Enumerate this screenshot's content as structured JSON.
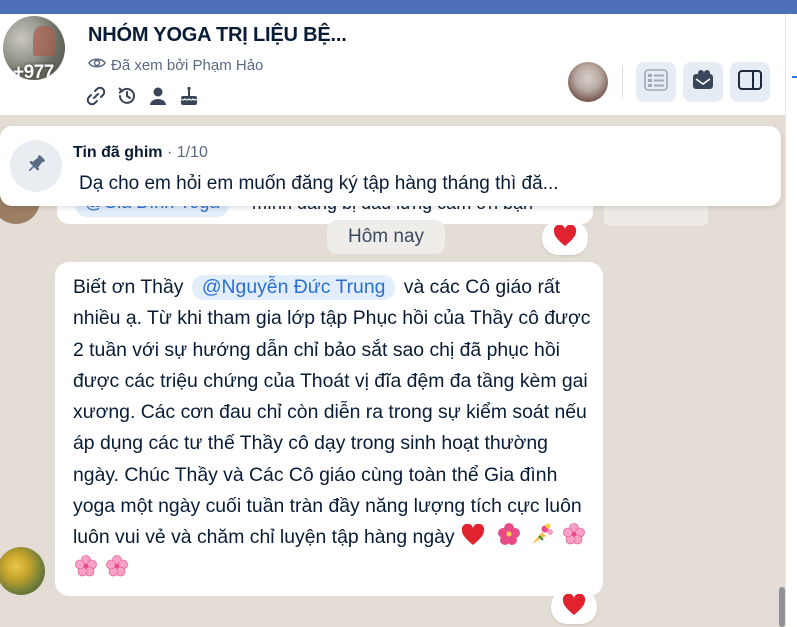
{
  "header": {
    "title": "NHÓM YOGA TRỊ LIỆU BỆ...",
    "avatar_badge": "+977",
    "seen_by": "Đã xem bởi Phạm Hảo",
    "icons": [
      "link-icon",
      "history-icon",
      "person-icon",
      "cake-icon"
    ],
    "buttons": [
      "message-list-icon",
      "group-inbox-icon",
      "sidebar-toggle-icon"
    ]
  },
  "pinned": {
    "label": "Tin đã ghim",
    "counter": "· 1/10",
    "text": "Dạ cho em hỏi em muốn đăng ký tập hàng tháng thì đă..."
  },
  "previous_message": {
    "mention": "@Gia Đình Yoga",
    "text": "mình đăng bị đau lưng cảm ơn bạn"
  },
  "date_separator": "Hôm nay",
  "message": {
    "text_1": "Biết ơn Thầy",
    "mention": "@Nguyễn Đức Trung",
    "text_2": "và các Cô giáo rất nhiều ạ. Từ khi tham gia lớp tập Phục hồi của Thầy cô được 2 tuần với sự hướng dẫn chỉ bảo sắt sao chị đã phục hồi được các triệu chứng của Thoát vị đĩa đệm đa tầng kèm gai xương. Các cơn đau chỉ còn diễn ra trong sự kiểm soát nếu áp dụng các tư thế Thầy cô dạy trong sinh hoạt thường ngày. Chúc Thầy và Các Cô giáo cùng toàn thể Gia đình yoga một ngày cuối tuần tràn đầy năng lượng tích cực luôn luôn vui vẻ và chăm chỉ luyện tập hàng ngày",
    "emojis": [
      "heart",
      "hibiscus",
      "bouquet",
      "cherry-blossom",
      "cherry-blossom",
      "cherry-blossom"
    ],
    "reaction": "heart"
  },
  "colors": {
    "top_bar": "#4d6fb8",
    "background": "#e4ddd6",
    "mention": "#2c6fd1",
    "heart": "#e0232e"
  }
}
